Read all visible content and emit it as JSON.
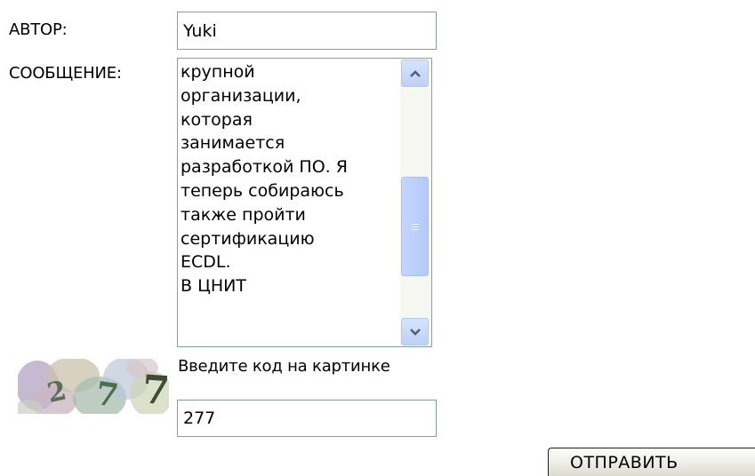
{
  "form": {
    "author_label": "АВТОР:",
    "author_value": "Yuki",
    "message_label": "СООБЩЕНИЕ:",
    "message_lines": [
      "крупной",
      "организации,",
      "которая",
      "занимается",
      "разработкой ПО. Я",
      "теперь собираюсь",
      "также пройти",
      "сертификацию",
      "ECDL.",
      "В ЦНИТ"
    ],
    "captcha_prompt": "Введите код на картинке",
    "captcha_image_text": "277",
    "captcha_value": "277",
    "submit_label": "ОТПРАВИТЬ"
  },
  "scrollbar": {
    "position_fraction": 0.55
  },
  "colors": {
    "input_border": "#7f9db9",
    "scrollbar_accent": "#4d6185",
    "scrollbar_button": "#c6d7fb"
  },
  "icons": [
    "scroll-up-arrow-icon",
    "scroll-down-arrow-icon",
    "scrollbar-grip-icon"
  ]
}
